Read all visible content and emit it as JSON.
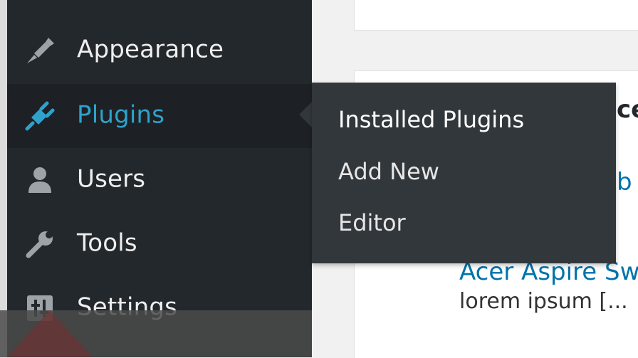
{
  "sidebar": {
    "items": [
      {
        "label": "Appearance",
        "icon": "paintbrush-icon"
      },
      {
        "label": "Plugins",
        "icon": "plug-icon",
        "active": true
      },
      {
        "label": "Users",
        "icon": "user-icon"
      },
      {
        "label": "Tools",
        "icon": "wrench-icon"
      },
      {
        "label": "Settings",
        "icon": "settings-icon"
      }
    ]
  },
  "submenu": {
    "items": [
      {
        "label": "Installed Plugins"
      },
      {
        "label": "Add New"
      },
      {
        "label": "Editor"
      }
    ]
  },
  "content": {
    "heading_fragment": "ce",
    "link_fragment_1": "b",
    "post_title_fragment": "Acer Aspire Sw",
    "excerpt_fragment": "lorem ipsum [..."
  },
  "colors": {
    "sidebar_bg": "#23282d",
    "active_accent": "#2ea2cc",
    "submenu_bg": "#32373c",
    "link_blue": "#0073aa"
  }
}
